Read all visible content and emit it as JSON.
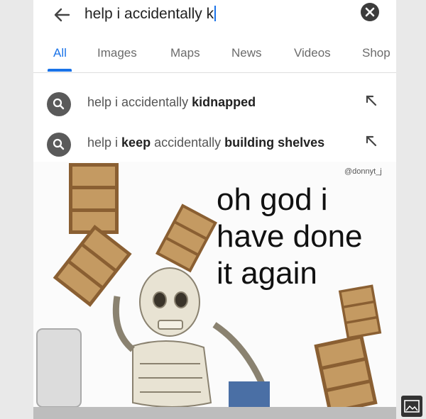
{
  "search": {
    "query": "help i accidentally k"
  },
  "tabs": [
    {
      "label": "All",
      "active": true
    },
    {
      "label": "Images"
    },
    {
      "label": "Maps"
    },
    {
      "label": "News"
    },
    {
      "label": "Videos"
    },
    {
      "label": "Shop"
    }
  ],
  "suggestions": [
    {
      "prefix": "help i accidentally ",
      "bold": "kidnapped",
      "rest": ""
    },
    {
      "prefix": "help i ",
      "bold": "keep",
      "rest": " accidentally ",
      "bold2": "building shelves"
    }
  ],
  "meme": {
    "watermark": "@donnyt_j",
    "caption_lines": [
      "oh god i",
      "have done",
      "it again"
    ]
  },
  "colors": {
    "accent": "#1a73e8",
    "shelf_wood": "#c49a62",
    "shelf_dark": "#8a5f32"
  },
  "icons": [
    "back-arrow-icon",
    "clear-icon",
    "search-icon",
    "fill-arrow-icon",
    "image-icon"
  ]
}
